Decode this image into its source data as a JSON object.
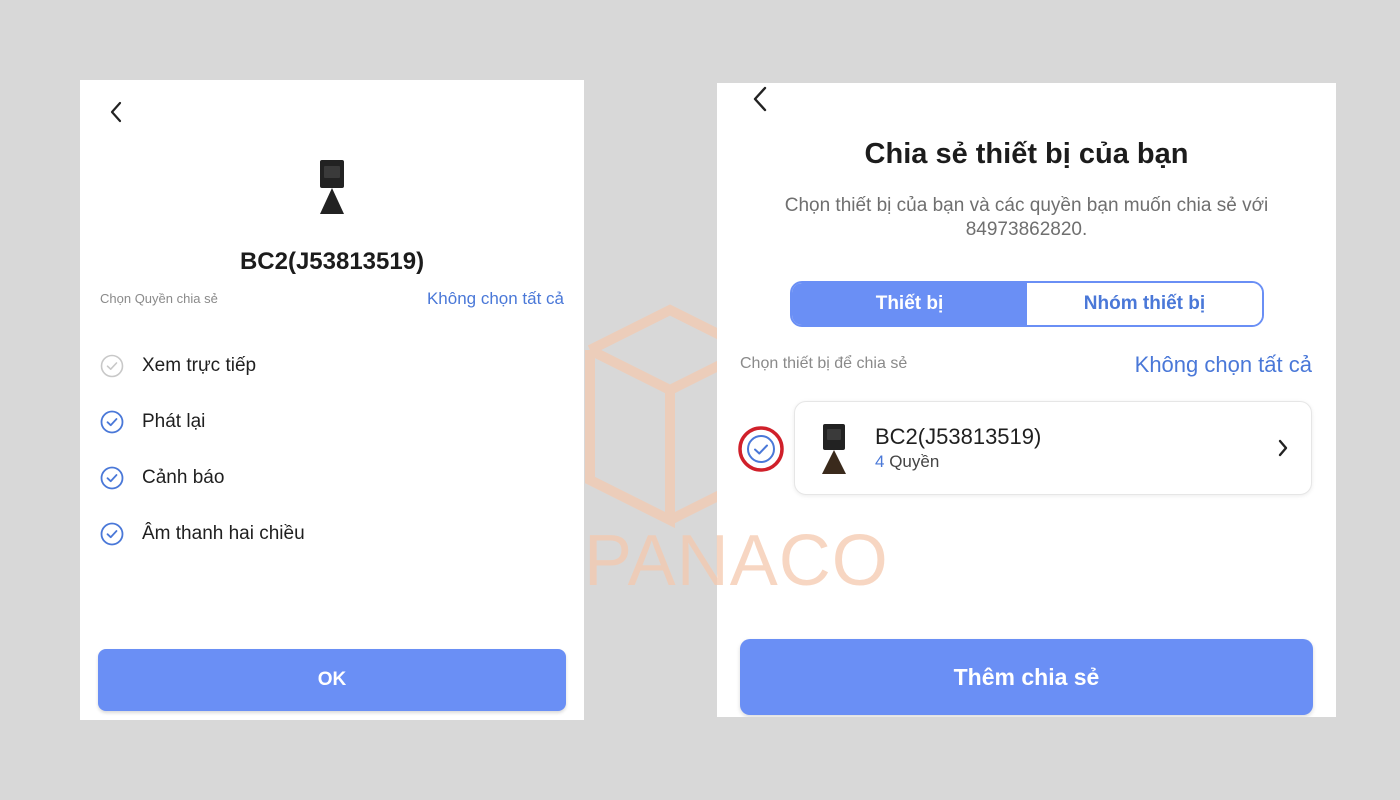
{
  "left_screen": {
    "device_title": "BC2(J53813519)",
    "section_label": "Chọn Quyền chia sẻ",
    "unselect_all": "Không chọn tất cả",
    "permissions": [
      {
        "label": "Xem trực tiếp",
        "checked": false
      },
      {
        "label": "Phát lại",
        "checked": true
      },
      {
        "label": "Cảnh báo",
        "checked": true
      },
      {
        "label": "Âm thanh hai chiều",
        "checked": true
      }
    ],
    "ok_label": "OK"
  },
  "right_screen": {
    "title": "Chia sẻ thiết bị của bạn",
    "description": "Chọn thiết bị của bạn và các quyền bạn muốn chia sẻ với 84973862820.",
    "tabs": [
      {
        "label": "Thiết bị",
        "active": true
      },
      {
        "label": "Nhóm thiết bị",
        "active": false
      }
    ],
    "section_label": "Chọn thiết bị để chia sẻ",
    "unselect_all": "Không chọn tất cả",
    "device": {
      "name": "BC2(J53813519)",
      "permission_count": "4",
      "permission_unit": "Quyền",
      "checked": true
    },
    "add_share_label": "Thêm chia sẻ"
  },
  "watermark": {
    "text": "PANACO"
  },
  "colors": {
    "accent": "#6a8ff5",
    "link": "#4a78d8",
    "highlight_ring": "#d0202a",
    "background": "#d8d8d8",
    "watermark": "#f5c9ae"
  },
  "icons": {
    "back": "chevron-left-icon",
    "device": "camera-icon",
    "check": "check-circle-icon",
    "next": "chevron-right-icon"
  }
}
